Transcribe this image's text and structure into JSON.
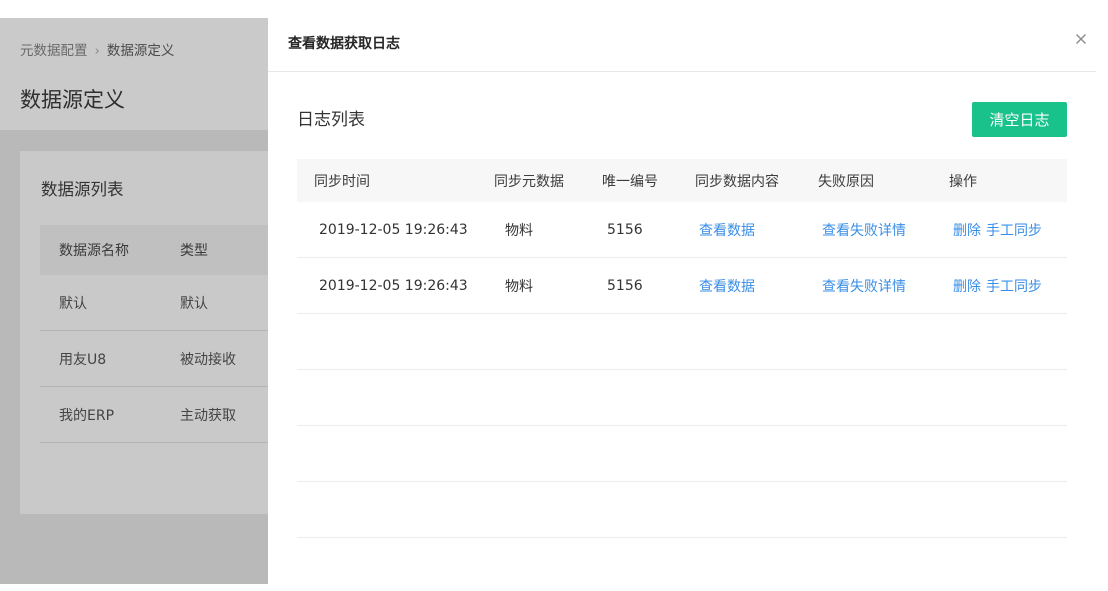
{
  "background_page": {
    "breadcrumb": {
      "parent": "元数据配置",
      "separator": "›",
      "current": "数据源定义"
    },
    "title": "数据源定义",
    "card": {
      "title": "数据源列表",
      "columns": [
        "数据源名称",
        "类型"
      ],
      "rows": [
        [
          "默认",
          "默认"
        ],
        [
          "用友U8",
          "被动接收"
        ],
        [
          "我的ERP",
          "主动获取"
        ]
      ]
    }
  },
  "drawer": {
    "title": "查看数据获取日志",
    "close_icon": "close-icon",
    "section_title": "日志列表",
    "clear_button": "清空日志",
    "table": {
      "columns": {
        "time": "同步时间",
        "meta": "同步元数据",
        "id": "唯一编号",
        "content": "同步数据内容",
        "reason": "失败原因",
        "op": "操作"
      },
      "rows": [
        {
          "time": "2019-12-05 19:26:43",
          "meta": "物料",
          "id": "5156",
          "content": "查看数据",
          "reason": "查看失败详情",
          "delete": "删除",
          "sync": "手工同步"
        },
        {
          "time": "2019-12-05 19:26:43",
          "meta": "物料",
          "id": "5156",
          "content": "查看数据",
          "reason": "查看失败详情",
          "delete": "删除",
          "sync": "手工同步"
        }
      ]
    }
  },
  "colors": {
    "primary_button": "#19c28a",
    "link": "#3a8ee6",
    "overlay": "#b9b9b9"
  }
}
